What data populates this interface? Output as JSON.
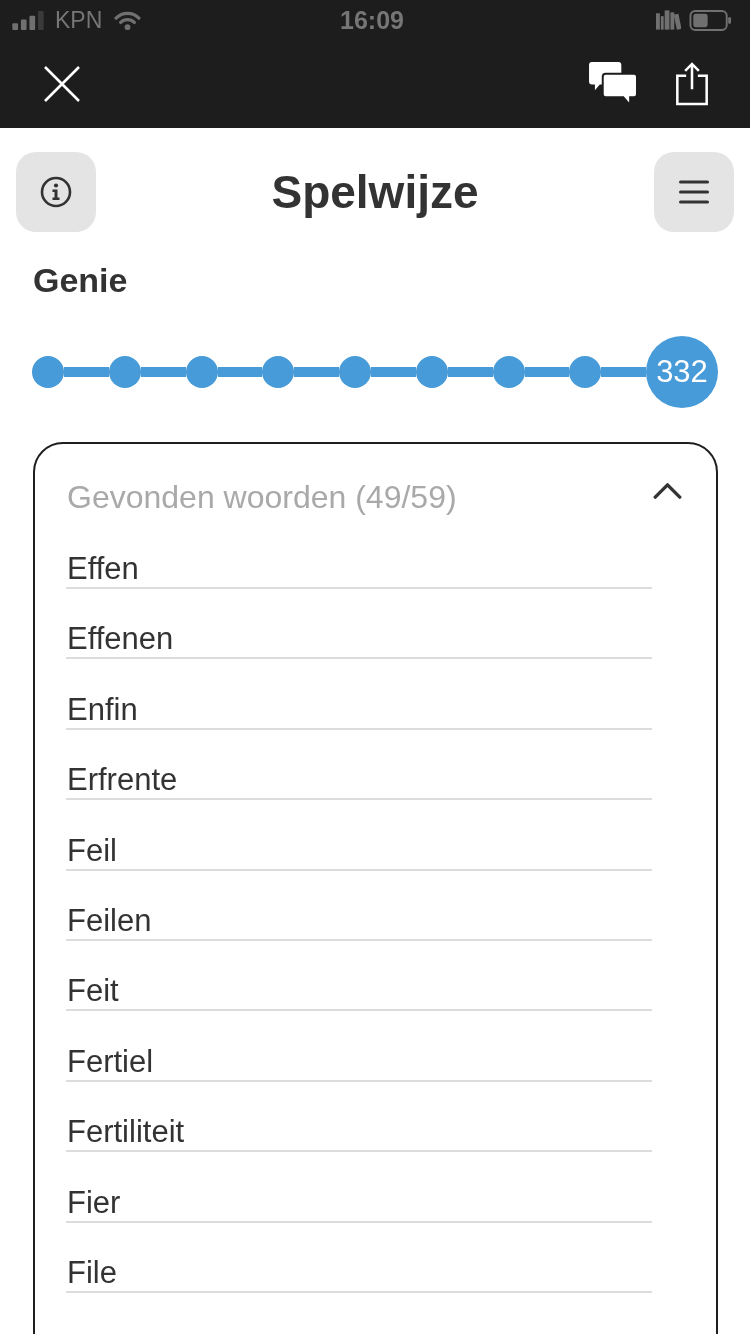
{
  "status_bar": {
    "carrier": "KPN",
    "time": "16:09"
  },
  "header": {
    "title": "Spelwijze"
  },
  "progress": {
    "rank": "Genie",
    "milestones": [
      {
        "reached": true
      },
      {
        "reached": true
      },
      {
        "reached": true
      },
      {
        "reached": true
      },
      {
        "reached": true
      },
      {
        "reached": true
      },
      {
        "reached": true
      },
      {
        "reached": true
      }
    ],
    "score": "332"
  },
  "found_words": {
    "title": "Gevonden woorden (49/59)",
    "expanded": true,
    "words": [
      "Effen",
      "Effenen",
      "Enfin",
      "Erfrente",
      "Feil",
      "Feilen",
      "Feit",
      "Fertiel",
      "Fertiliteit",
      "Fier",
      "File"
    ]
  }
}
